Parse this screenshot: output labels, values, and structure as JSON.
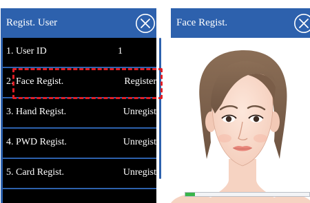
{
  "left_screen": {
    "title": "Regist. User",
    "close_icon": "close-circle-icon",
    "menu": [
      {
        "label": "1. User ID",
        "value": "1"
      },
      {
        "label": "2. Face Regist.",
        "value": "Register"
      },
      {
        "label": "3. Hand Regist.",
        "value": "Unregist"
      },
      {
        "label": "4. PWD Regist.",
        "value": "Unregist"
      },
      {
        "label": "5. Card Regist.",
        "value": "Unregist"
      }
    ],
    "highlighted_item": "2. Face Regist."
  },
  "right_screen": {
    "title": "Face Regist.",
    "close_icon": "close-circle-icon",
    "face_image": "face-illustration",
    "progress_percent": 8
  },
  "colors": {
    "accent": "#2d61ad",
    "list_background": "#000000",
    "highlight": "#e11d24",
    "progress": "#38b54a"
  }
}
